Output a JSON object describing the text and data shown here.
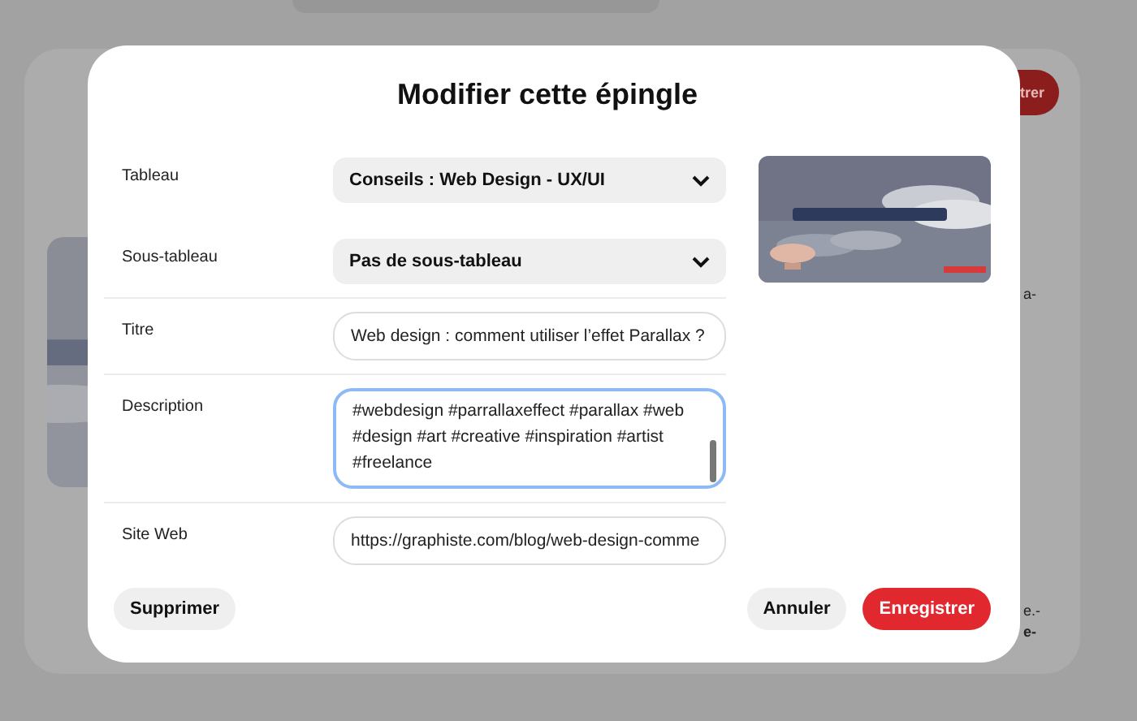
{
  "background": {
    "button": "trer",
    "fragments": [
      "a-",
      "e.-",
      "e-"
    ]
  },
  "dialog": {
    "title": "Modifier cette épingle",
    "fields": [
      {
        "kind": "select",
        "label": "Tableau",
        "value": "Conseils : Web Design - UX/UI"
      },
      {
        "kind": "select",
        "label": "Sous-tableau",
        "value": "Pas de sous-tableau"
      },
      {
        "kind": "input",
        "label": "Titre",
        "value": "Web design : comment utiliser l’effet Parallax ?"
      },
      {
        "kind": "textarea",
        "label": "Description",
        "value": "#webdesign #parrallaxeffect #parallax #web #design #art #creative #inspiration #artist #freelance",
        "focused": true
      },
      {
        "kind": "input",
        "label": "Site Web",
        "value": "https://graphiste.com/blog/web-design-comme"
      }
    ],
    "buttons": [
      {
        "label": "Supprimer",
        "kind": "secondary"
      },
      {
        "label": "Annuler",
        "kind": "secondary"
      },
      {
        "label": "Enregistrer",
        "kind": "primary"
      }
    ]
  }
}
